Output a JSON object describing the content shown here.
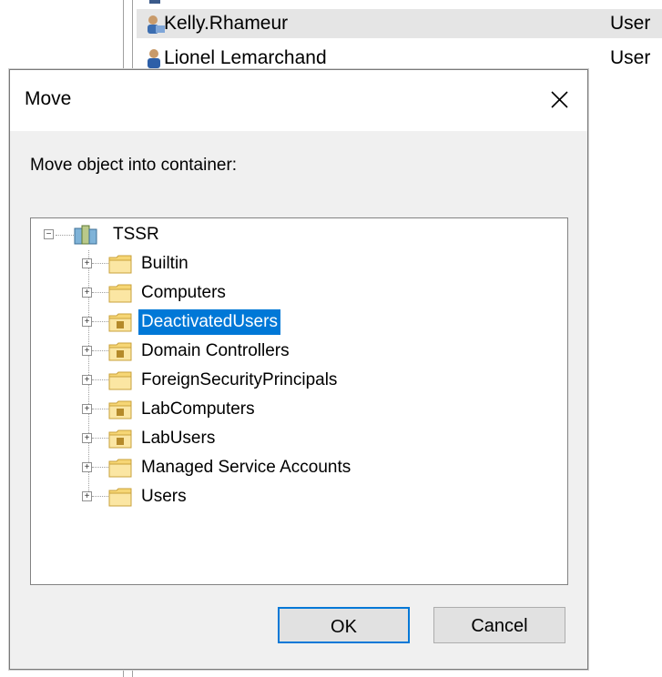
{
  "background_list": {
    "rows": [
      {
        "name": "Kelly.Rhameur",
        "type": "User",
        "selected": true
      },
      {
        "name": "Lionel Lemarchand",
        "type": "User",
        "selected": false
      }
    ]
  },
  "dialog": {
    "title": "Move",
    "prompt": "Move object into container:",
    "tree": {
      "root": "TSSR",
      "children": [
        {
          "label": "Builtin",
          "icon": "folder-icon"
        },
        {
          "label": "Computers",
          "icon": "folder-icon"
        },
        {
          "label": "DeactivatedUsers",
          "icon": "ou-folder-icon",
          "selected": true
        },
        {
          "label": "Domain Controllers",
          "icon": "ou-folder-icon"
        },
        {
          "label": "ForeignSecurityPrincipals",
          "icon": "folder-icon"
        },
        {
          "label": "LabComputers",
          "icon": "ou-folder-icon"
        },
        {
          "label": "LabUsers",
          "icon": "ou-folder-icon"
        },
        {
          "label": "Managed Service Accounts",
          "icon": "folder-icon"
        },
        {
          "label": "Users",
          "icon": "folder-icon"
        }
      ]
    },
    "buttons": {
      "ok": "OK",
      "cancel": "Cancel"
    }
  },
  "colors": {
    "selection": "#0078d7",
    "dialog_bg": "#f0f0f0",
    "folder": "#f6d675"
  }
}
